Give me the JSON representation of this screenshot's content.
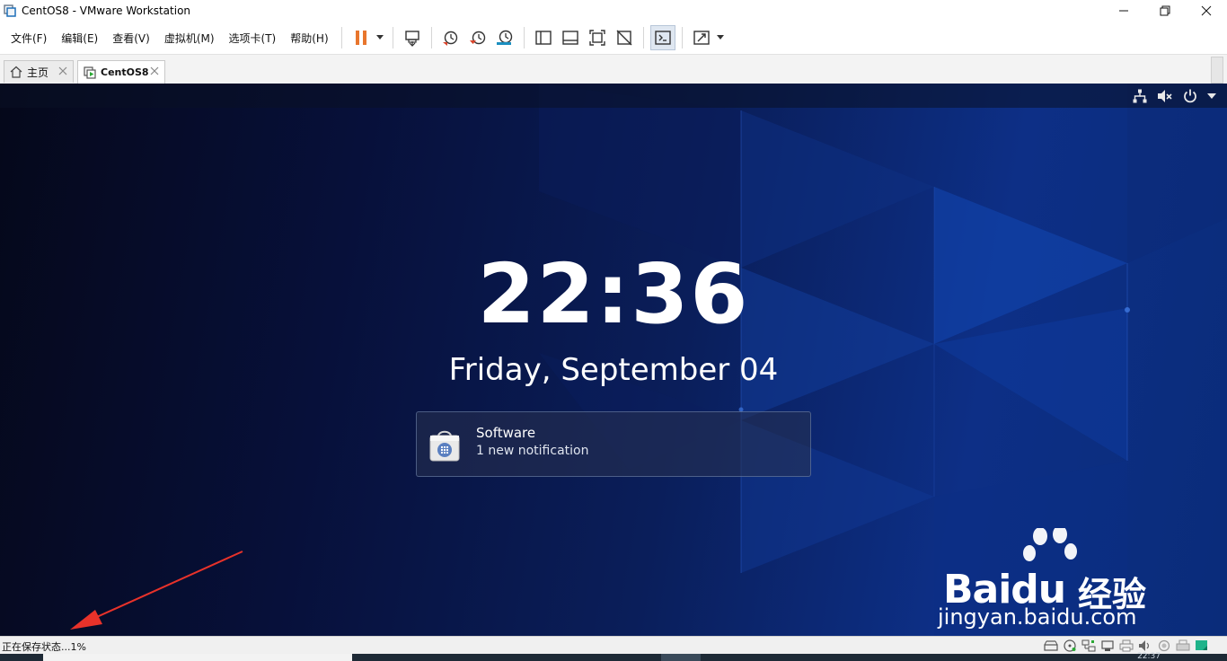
{
  "window": {
    "title": "CentOS8 - VMware Workstation"
  },
  "menu": {
    "items": [
      "文件(F)",
      "编辑(E)",
      "查看(V)",
      "虚拟机(M)",
      "选项卡(T)",
      "帮助(H)"
    ]
  },
  "toolbar": {
    "buttons": [
      "pause-icon",
      "send-keys-icon",
      "snapshot-icon",
      "revert-snapshot-icon",
      "snapshot-manager-icon",
      "sidebar-icon",
      "thumbnail-bar-icon",
      "fullscreen-icon",
      "unity-icon",
      "console-icon",
      "stretch-icon"
    ],
    "accent": "#e8762d"
  },
  "tabs": [
    {
      "label": "主页",
      "icon": "home-icon",
      "active": false
    },
    {
      "label": "CentOS8",
      "icon": "vm-running-icon",
      "active": true
    }
  ],
  "vm": {
    "top_bar_icons": [
      "network-icon",
      "volume-muted-icon",
      "power-icon",
      "chevron-down-icon"
    ],
    "clock": "22:36",
    "date": "Friday, September 04",
    "notification": {
      "icon": "software-bag-icon",
      "title": "Software",
      "body": "1 new notification"
    }
  },
  "watermark": {
    "brand": "Baidu",
    "brand_cn": "经验",
    "url": "jingyan.baidu.com"
  },
  "statusbar": {
    "text": "正在保存状态...1%",
    "icons": [
      "hdd-icon",
      "cdrom-icon",
      "network-adapter-icon",
      "usb-icon",
      "printer-icon",
      "sound-icon",
      "display-icon",
      "printer2-icon",
      "message-icon"
    ]
  },
  "taskbar": {
    "clock": "22:37"
  }
}
